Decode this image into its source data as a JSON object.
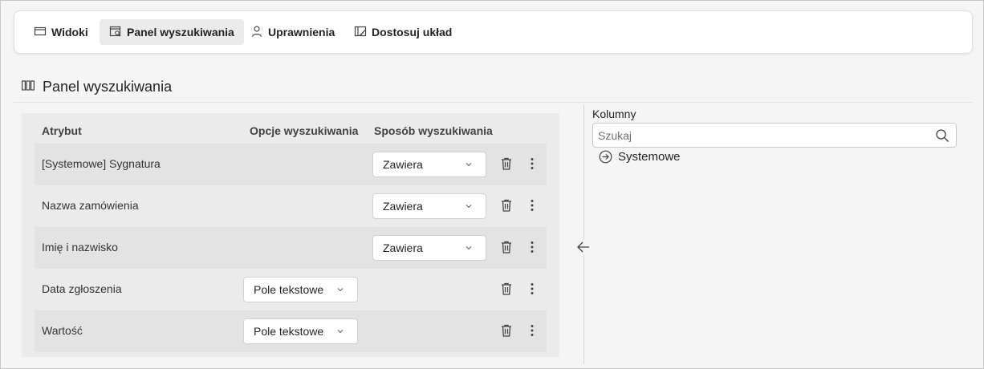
{
  "tabs": [
    {
      "label": "Widoki",
      "icon": "window-icon",
      "active": false
    },
    {
      "label": "Panel wyszukiwania",
      "icon": "search-panel-icon",
      "active": true
    },
    {
      "label": "Uprawnienia",
      "icon": "person-icon",
      "active": false
    },
    {
      "label": "Dostosuj układ",
      "icon": "layout-ruler-icon",
      "active": false
    }
  ],
  "section": {
    "title": "Panel wyszukiwania",
    "icon": "columns-icon"
  },
  "table": {
    "headers": {
      "attribute": "Atrybut",
      "search_options": "Opcje wyszukiwania",
      "search_method": "Sposób wyszukiwania"
    },
    "rows": [
      {
        "name": "[Systemowe] Sygnatura",
        "method": "Zawiera"
      },
      {
        "name": "Nazwa zamówienia",
        "method": "Zawiera"
      },
      {
        "name": "Imię i nazwisko",
        "method": "Zawiera"
      },
      {
        "name": "Data zgłoszenia",
        "option": "Pole tekstowe"
      },
      {
        "name": "Wartość",
        "option": "Pole tekstowe"
      }
    ]
  },
  "columns_panel": {
    "label": "Kolumny",
    "search_placeholder": "Szukaj",
    "tree": [
      {
        "label": "Systemowe",
        "icon": "arrow-circle-right-icon"
      }
    ]
  }
}
